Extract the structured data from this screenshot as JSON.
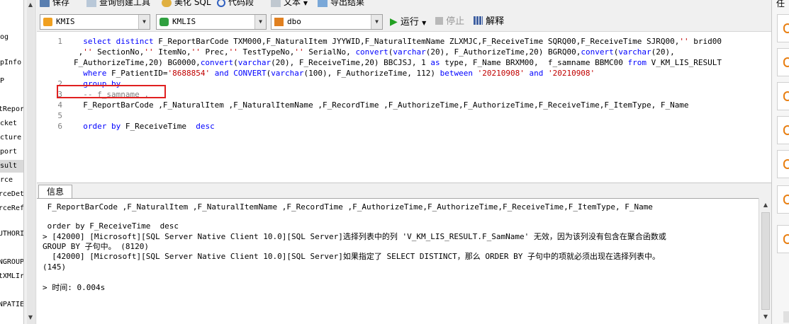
{
  "left_panel": {
    "items": [
      {
        "label": "og",
        "selected": false
      },
      {
        "label": "pInfo",
        "selected": false
      },
      {
        "label": "P",
        "selected": false
      },
      {
        "label": "tRepor",
        "selected": false
      },
      {
        "label": "cket",
        "selected": false
      },
      {
        "label": "cture",
        "selected": false
      },
      {
        "label": "port",
        "selected": false
      },
      {
        "label": "sult",
        "selected": true
      },
      {
        "label": "rce",
        "selected": false
      },
      {
        "label": "rceDet",
        "selected": false
      },
      {
        "label": "rceRef",
        "selected": false
      },
      {
        "label": "UTHORI",
        "selected": false
      },
      {
        "label": "NGROUP",
        "selected": false
      },
      {
        "label": "tXMLIr",
        "selected": false
      },
      {
        "label": "NPATIE",
        "selected": false
      }
    ]
  },
  "toolbar_top": {
    "save": "保存",
    "query_builder": "查询创建工具",
    "beautify_sql": "美化 SQL",
    "code_snippet": "代码段",
    "text": "文本",
    "export_result": "导出结果"
  },
  "toolbar": {
    "connection": "KMIS",
    "database": "KMLIS",
    "schema": "dbo",
    "run": "运行",
    "stop": "停止",
    "explain": "解释"
  },
  "editor": {
    "line_numbers": [
      "1",
      "2",
      "3",
      "4",
      "5",
      "6"
    ]
  },
  "info": {
    "tab_label": "信息",
    "messages": [
      " F_ReportBarCode ,F_NaturalItem ,F_NaturalItemName ,F_RecordTime ,F_AuthorizeTime,F_AuthorizeTime,F_ReceiveTime,F_ItemType, F_Name",
      "",
      " order by F_ReceiveTime  desc",
      "> [42000] [Microsoft][SQL Server Native Client 10.0][SQL Server]选择列表中的列 'V_KM_LIS_RESULT.F_SamName' 无效，因为该列没有包含在聚合函数或",
      "GROUP BY 子句中。 (8120)",
      "  [42000] [Microsoft][SQL Server Native Client 10.0][SQL Server]如果指定了 SELECT DISTINCT，那么 ORDER BY 子句中的项就必须出现在选择列表中。",
      "(145)",
      "",
      "> 时间: 0.004s"
    ]
  },
  "right_panel": {
    "title": "任"
  },
  "colors": {
    "keyword": "#0000ff",
    "string": "#c00000",
    "comment": "#808080",
    "highlight": "#e02020",
    "run_green": "#22a022"
  }
}
